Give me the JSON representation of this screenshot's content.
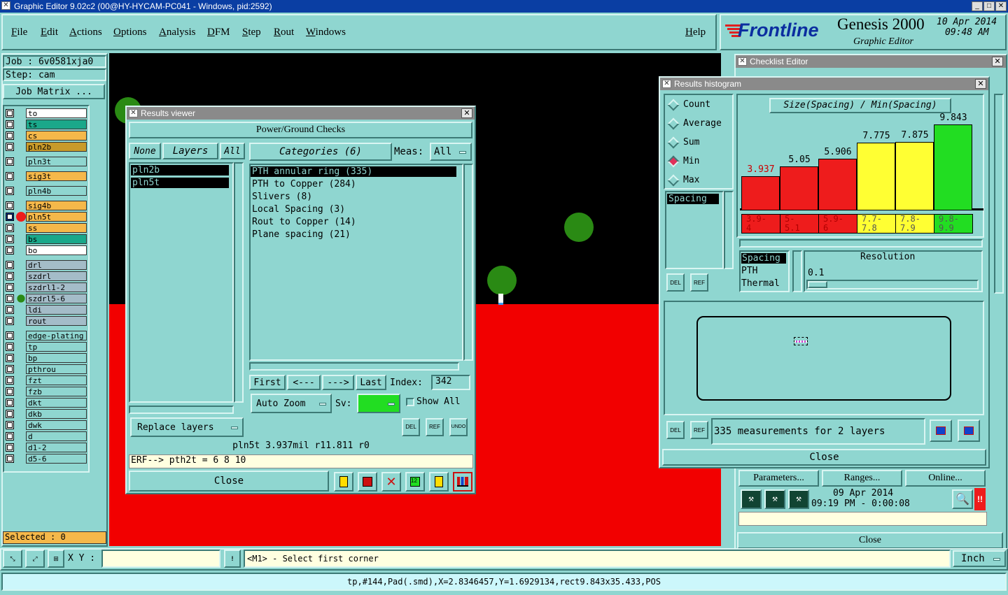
{
  "app": {
    "title": "Graphic Editor 9.02c2 (00@HY-HYCAM-PC041 - Windows, pid:2592)"
  },
  "menu": [
    "File",
    "Edit",
    "Actions",
    "Options",
    "Analysis",
    "DFM",
    "Step",
    "Rout",
    "Windows"
  ],
  "help": "Help",
  "brand": {
    "logo": "Frontline",
    "product": "Genesis 2000",
    "subtitle": "Graphic Editor",
    "date": "10 Apr 2014",
    "time": "09:48 AM"
  },
  "job": {
    "label": "Job : 6v0581xja0",
    "step": "Step: cam",
    "matrix_btn": "Job Matrix ...",
    "selected": "Selected : 0"
  },
  "layers": [
    {
      "name": "to",
      "color": "#ffffff"
    },
    {
      "name": "ts",
      "color": "#1aa88a"
    },
    {
      "name": "cs",
      "color": "#f5b84a"
    },
    {
      "name": "pln2b",
      "color": "#c89a2a"
    },
    {
      "name": "pln3t",
      "color": "#8fd6d0"
    },
    {
      "name": "sig3t",
      "color": "#f5b84a"
    },
    {
      "name": "pln4b",
      "color": "#8fd6d0"
    },
    {
      "name": "sig4b",
      "color": "#f5b84a"
    },
    {
      "name": "pln5t",
      "color": "#f5b84a"
    },
    {
      "name": "ss",
      "color": "#f5b84a"
    },
    {
      "name": "bs",
      "color": "#1aa88a"
    },
    {
      "name": "bo",
      "color": "#ffffff"
    },
    {
      "name": "drl",
      "color": "#a4bcc8"
    },
    {
      "name": "szdrl",
      "color": "#a4bcc8"
    },
    {
      "name": "szdrl1-2",
      "color": "#a4bcc8"
    },
    {
      "name": "szdrl5-6",
      "color": "#a4bcc8"
    },
    {
      "name": "ldi",
      "color": "#a4bcc8"
    },
    {
      "name": "rout",
      "color": "#a4bcc8"
    },
    {
      "name": "edge-plating",
      "color": "#8fd6d0"
    },
    {
      "name": "tp",
      "color": "#8fd6d0"
    },
    {
      "name": "bp",
      "color": "#8fd6d0"
    },
    {
      "name": "pthrou",
      "color": "#8fd6d0"
    },
    {
      "name": "fzt",
      "color": "#8fd6d0"
    },
    {
      "name": "fzb",
      "color": "#8fd6d0"
    },
    {
      "name": "dkt",
      "color": "#8fd6d0"
    },
    {
      "name": "dkb",
      "color": "#8fd6d0"
    },
    {
      "name": "dwk",
      "color": "#8fd6d0"
    },
    {
      "name": "d",
      "color": "#8fd6d0"
    },
    {
      "name": "d1-2",
      "color": "#8fd6d0"
    },
    {
      "name": "d5-6",
      "color": "#8fd6d0"
    }
  ],
  "results_viewer": {
    "title": "Results viewer",
    "header": "Power/Ground Checks",
    "none": "None",
    "layers": "Layers",
    "all": "All",
    "layer_items": [
      "pln2b",
      "pln5t"
    ],
    "categories": "Categories (6)",
    "meas_label": "Meas:",
    "meas_value": "All",
    "category_items": [
      "PTH annular ring (335)",
      "PTH to Copper (284)",
      "Slivers (8)",
      "Local Spacing (3)",
      "Rout to Copper (14)",
      "Plane spacing (21)"
    ],
    "first": "First",
    "prev": "<---",
    "next": "--->",
    "last": "Last",
    "index_label": "Index:",
    "index_value": "342",
    "auto_zoom": "Auto Zoom",
    "sv": "Sv:",
    "show_all": "Show All",
    "replace_layers": "Replace layers",
    "del": "DEL",
    "ref": "REF",
    "undo": "UNDO",
    "status": "pln5t 3.937mil  r11.811  r0",
    "erf": "ERF--> pth2t = 6 8 10",
    "close": "Close"
  },
  "checklist": {
    "title": "Checklist Editor",
    "parameters": "Parameters...",
    "ranges": "Ranges...",
    "online": "Online...",
    "date": "09 Apr 2014",
    "time": "09:19 PM - 0:00:08",
    "close": "Close"
  },
  "histogram": {
    "title": "Results histogram",
    "modes": [
      "Count",
      "Average",
      "Sum",
      "Min",
      "Max"
    ],
    "selected_mode": "Min",
    "list_item": "Spacing",
    "chart_title": "Size(Spacing) / Min(Spacing)",
    "bars": [
      {
        "value": "3.937",
        "range": "3.9-\n4",
        "color": "#ee1c1c",
        "level": 0.4
      },
      {
        "value": "5.05",
        "range": "5-\n5.1",
        "color": "#ee1c1c",
        "level": 0.51
      },
      {
        "value": "5.906",
        "range": "5.9-\n6",
        "color": "#ee1c1c",
        "level": 0.6
      },
      {
        "value": "7.775",
        "range": "7.7-\n7.8",
        "color": "#ffff33",
        "level": 0.79
      },
      {
        "value": "7.875",
        "range": "7.8-\n7.9",
        "color": "#ffff33",
        "level": 0.8
      },
      {
        "value": "9.843",
        "range": "9.8-\n9.9",
        "color": "#22dd22",
        "level": 1.0
      }
    ],
    "types": [
      "Spacing",
      "PTH",
      "Thermal"
    ],
    "resolution_label": "Resolution",
    "resolution_value": "0.1",
    "measurements": "335 measurements for 2 layers",
    "close": "Close",
    "del": "DEL",
    "ref": "REF"
  },
  "bottom": {
    "xy_label": "X Y :",
    "prompt": "<M1> - Select first corner",
    "units": "Inch",
    "status_line": "tp,#144,Pad(.smd),X=2.8346457,Y=1.6929134,rect9.843x35.433,POS"
  }
}
